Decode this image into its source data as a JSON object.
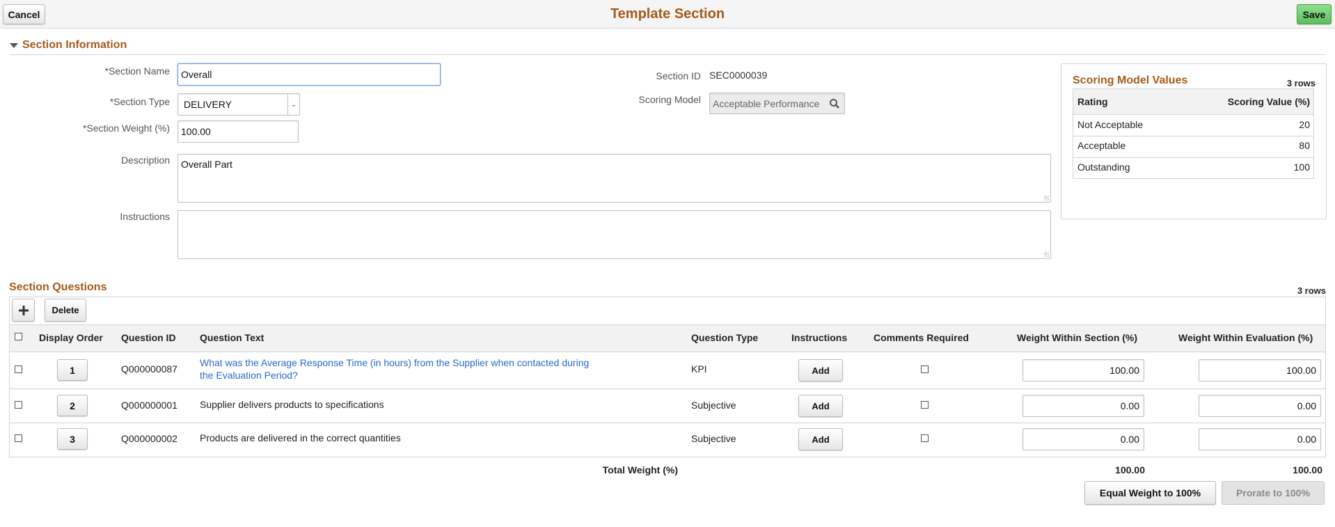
{
  "header": {
    "title": "Template Section",
    "cancel_label": "Cancel",
    "save_label": "Save"
  },
  "section_info": {
    "heading": "Section Information",
    "section_name_label": "*Section Name",
    "section_name_value": "Overall",
    "section_type_label": "*Section Type",
    "section_type_value": "DELIVERY",
    "section_weight_label": "*Section Weight (%)",
    "section_weight_value": "100.00",
    "description_label": "Description",
    "description_value": "Overall Part",
    "instructions_label": "Instructions",
    "instructions_value": "",
    "section_id_label": "Section ID",
    "section_id_value": "SEC0000039",
    "scoring_model_label": "Scoring Model",
    "scoring_model_value": "Acceptable Performance"
  },
  "scoring_values": {
    "heading": "Scoring Model Values",
    "row_count": "3 rows",
    "col_rating": "Rating",
    "col_value": "Scoring Value (%)",
    "rows": [
      {
        "rating": "Not Acceptable",
        "value": "20"
      },
      {
        "rating": "Acceptable",
        "value": "80"
      },
      {
        "rating": "Outstanding",
        "value": "100"
      }
    ]
  },
  "questions": {
    "heading": "Section Questions",
    "row_count": "3 rows",
    "add_icon": "plus-icon",
    "delete_label": "Delete",
    "columns": {
      "display_order": "Display Order",
      "question_id": "Question ID",
      "question_text": "Question Text",
      "question_type": "Question Type",
      "instructions": "Instructions",
      "comments_required": "Comments Required",
      "weight_section": "Weight Within Section (%)",
      "weight_evaluation": "Weight Within Evaluation (%)"
    },
    "rows": [
      {
        "order": "1",
        "id": "Q000000087",
        "text_line1": "What was the Average Response Time (in hours) from the Supplier when contacted during",
        "text_line2": "the Evaluation Period?",
        "type": "KPI",
        "add_label": "Add",
        "weight_section": "100.00",
        "weight_evaluation": "100.00"
      },
      {
        "order": "2",
        "id": "Q000000001",
        "text_line1": "Supplier delivers products to specifications",
        "text_line2": "",
        "type": "Subjective",
        "add_label": "Add",
        "weight_section": "0.00",
        "weight_evaluation": "0.00"
      },
      {
        "order": "3",
        "id": "Q000000002",
        "text_line1": "Products are delivered in the correct quantities",
        "text_line2": "",
        "type": "Subjective",
        "add_label": "Add",
        "weight_section": "0.00",
        "weight_evaluation": "0.00"
      }
    ],
    "total_label": "Total Weight (%)",
    "total_section": "100.00",
    "total_evaluation": "100.00",
    "equal_weight_label": "Equal Weight to 100%",
    "prorate_label": "Prorate to 100%"
  },
  "colors": {
    "accent": "#a65a1b",
    "link": "#2a6ad0",
    "save_green": "#5cbf5c"
  }
}
